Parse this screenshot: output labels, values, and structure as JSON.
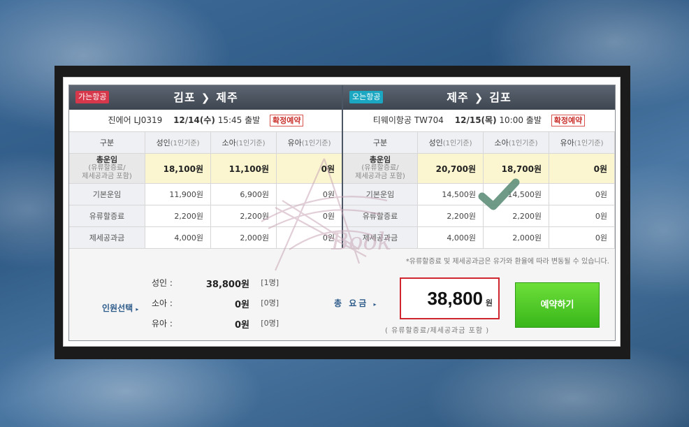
{
  "outbound": {
    "tag": "가는항공",
    "origin": "김포",
    "destination": "제주",
    "airline": "진에어",
    "flight_no": "LJ0319",
    "date": "12/14(수)",
    "time": "15:45 출발",
    "status": "확정예약",
    "headers": {
      "col0": "구분",
      "col1": "성인",
      "col1_sub": "(1인기준)",
      "col2": "소아",
      "col2_sub": "(1인기준)",
      "col3": "유아",
      "col3_sub": "(1인기준)"
    },
    "total_row": {
      "label_main": "총운임",
      "label_sub1": "(유류할증료/",
      "label_sub2": "제세공과금 포함)",
      "adult": "18,100원",
      "child": "11,100원",
      "infant": "0원"
    },
    "rows": [
      {
        "label": "기본운임",
        "adult": "11,900원",
        "child": "6,900원",
        "infant": "0원"
      },
      {
        "label": "유류할증료",
        "adult": "2,200원",
        "child": "2,200원",
        "infant": "0원"
      },
      {
        "label": "제세공과금",
        "adult": "4,000원",
        "child": "2,000원",
        "infant": "0원"
      }
    ]
  },
  "inbound": {
    "tag": "오는항공",
    "origin": "제주",
    "destination": "김포",
    "airline": "티웨이항공",
    "flight_no": "TW704",
    "date": "12/15(목)",
    "time": "10:00 출발",
    "status": "확정예약",
    "headers": {
      "col0": "구분",
      "col1": "성인",
      "col1_sub": "(1인기준)",
      "col2": "소아",
      "col2_sub": "(1인기준)",
      "col3": "유아",
      "col3_sub": "(1인기준)"
    },
    "total_row": {
      "label_main": "총운임",
      "label_sub1": "(유류할증료/",
      "label_sub2": "제세공과금 포함)",
      "adult": "20,700원",
      "child": "18,700원",
      "infant": "0원"
    },
    "rows": [
      {
        "label": "기본운임",
        "adult": "14,500원",
        "child": "14,500원",
        "infant": "0원"
      },
      {
        "label": "유류할증료",
        "adult": "2,200원",
        "child": "2,200원",
        "infant": "0원"
      },
      {
        "label": "제세공과금",
        "adult": "4,000원",
        "child": "2,000원",
        "infant": "0원"
      }
    ]
  },
  "notice": "*유류할증료 및 제세공과금은 유가와 환율에 따라 변동될 수 있습니다.",
  "summary": {
    "people_title": "인원선택",
    "adult_label": "성인 :",
    "adult_amount": "38,800원",
    "adult_count": "[1명]",
    "child_label": "소아 :",
    "child_amount": "0원",
    "child_count": "[0명]",
    "infant_label": "유아 :",
    "infant_amount": "0원",
    "infant_count": "[0명]",
    "total_label": "총 요금",
    "total_amount": "38,800",
    "total_unit": "원",
    "total_note": "( 유류할증료/제세공과금 포함 )",
    "reserve_button": "예약하기"
  },
  "watermark_text": "Book",
  "colors": {
    "accent_red": "#d0262f",
    "button_green": "#4cc52a",
    "highlight_yellow": "#fbf6cf",
    "header_dark": "#4a525d"
  }
}
